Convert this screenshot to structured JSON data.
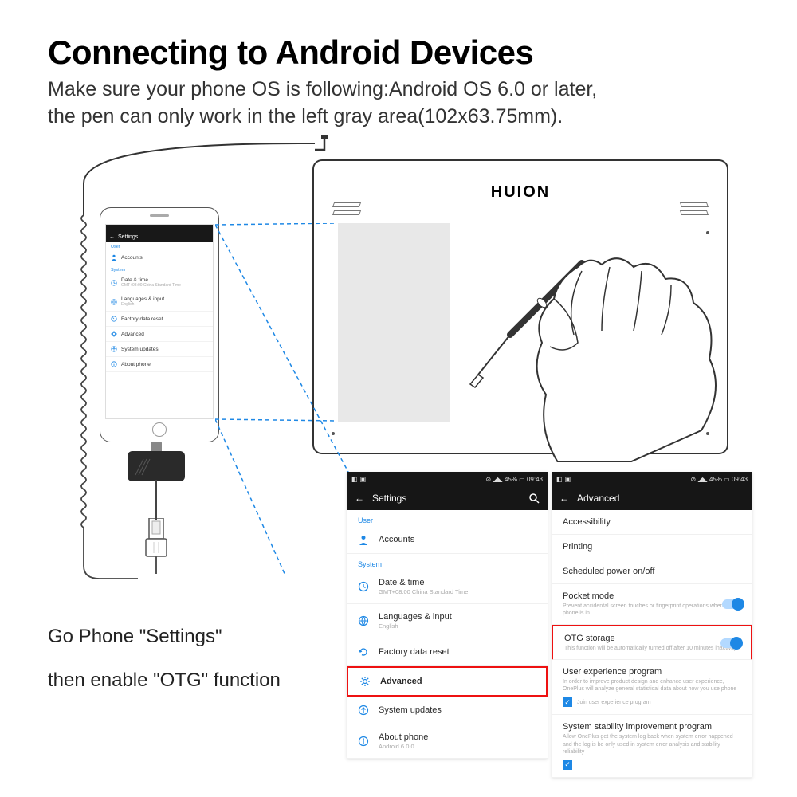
{
  "heading": "Connecting to Android Devices",
  "subtext_line1": "Make sure your phone OS is following:Android OS 6.0 or later,",
  "subtext_line2": "the pen can only work in the left gray area(102x63.75mm).",
  "instruction1": "Go Phone \"Settings\"",
  "instruction2": "then enable \"OTG\" function",
  "tablet": {
    "brand": "HUION"
  },
  "status": {
    "battery": "45%",
    "time": "09:43"
  },
  "settings_title": "Settings",
  "advanced_title": "Advanced",
  "sections": {
    "user": "User",
    "system": "System"
  },
  "items": {
    "accounts": "Accounts",
    "date_time": "Date & time",
    "date_time_sub": "GMT+08:00 China Standard Time",
    "languages": "Languages & input",
    "languages_sub": "English",
    "factory": "Factory data reset",
    "advanced": "Advanced",
    "system_updates": "System updates",
    "about": "About phone",
    "about_sub": "Android 6.0.0"
  },
  "advanced_items": {
    "accessibility": "Accessibility",
    "printing": "Printing",
    "scheduled": "Scheduled power on/off",
    "pocket": "Pocket mode",
    "pocket_sub": "Prevent accidental screen touches or fingerprint operations when the phone is in",
    "otg": "OTG storage",
    "otg_sub": "This function will be automatically turned off after 10 minutes inactivity",
    "ux": "User experience program",
    "ux_sub": "In order to improve product design and enhance user experience, OnePlus will analyze general statistical data about how you use phone",
    "ux_check": "Join user experience program",
    "stability": "System stability improvement program",
    "stability_sub": "Allow OnePlus get the system log back when system error happened and the log is be only used in system error analysis and stability reliability",
    "stability_check": ""
  }
}
